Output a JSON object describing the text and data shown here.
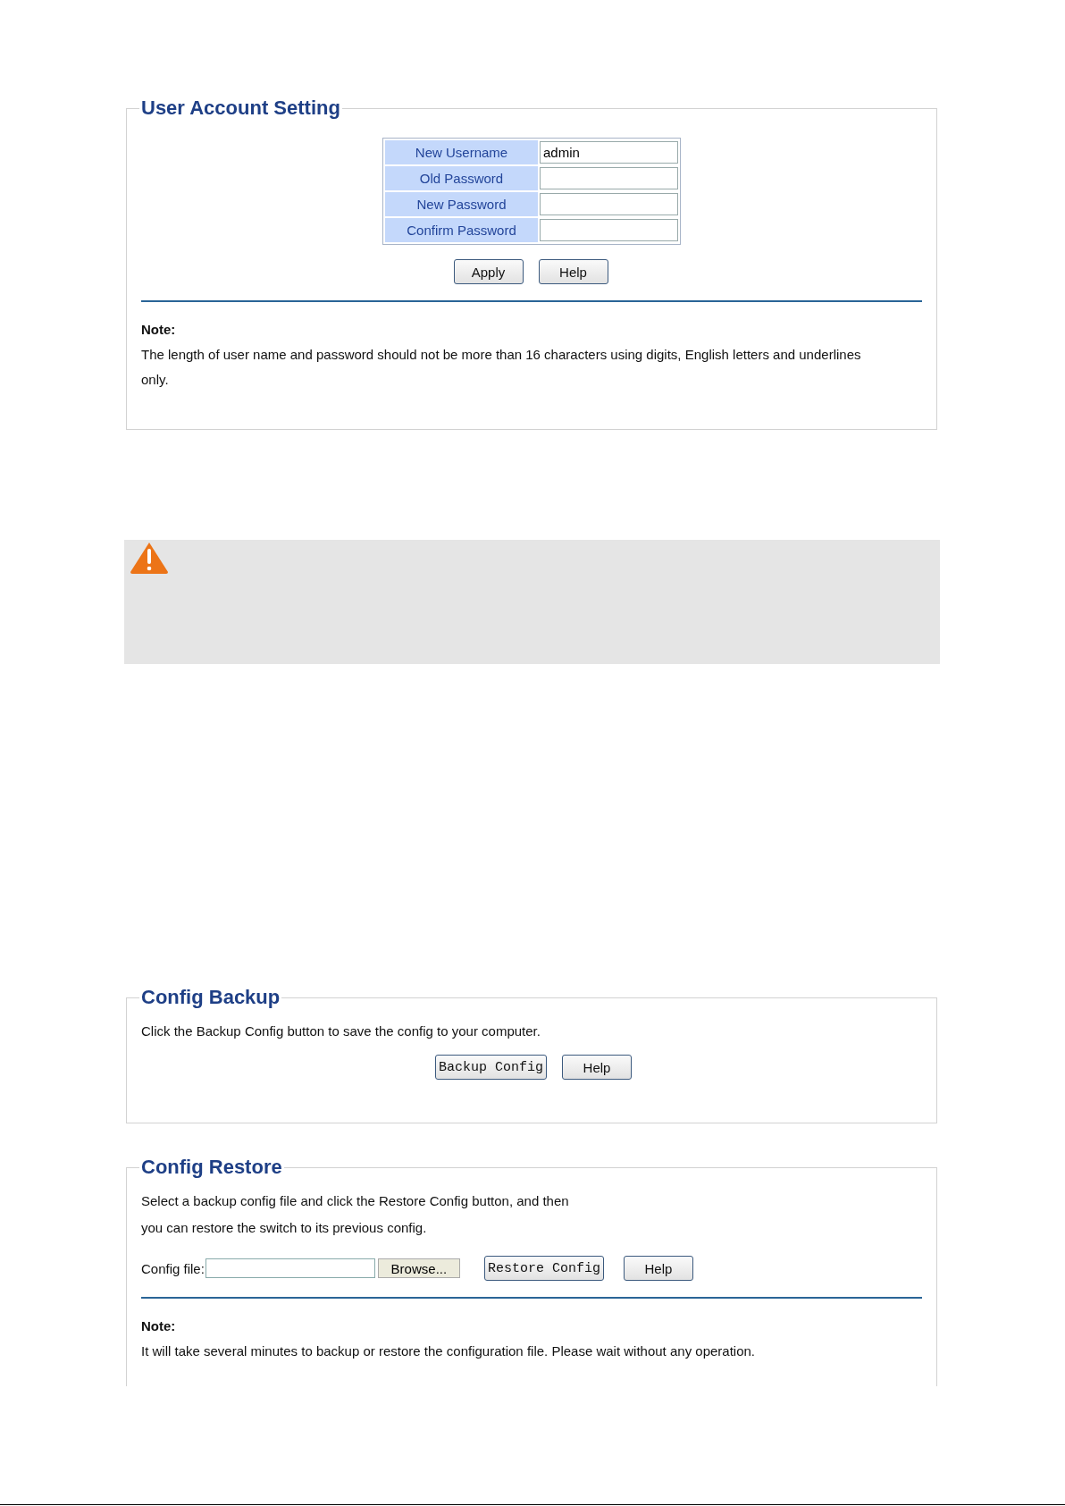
{
  "user_account": {
    "title": "User Account Setting",
    "fields": [
      {
        "label": "New Username",
        "value": "admin"
      },
      {
        "label": "Old Password"
      },
      {
        "label": "New Password"
      },
      {
        "label": "Confirm Password"
      }
    ],
    "buttons": [
      {
        "label": "Apply",
        "kind": "plain"
      },
      {
        "label": "Help",
        "kind": "plain"
      }
    ],
    "note_title": "Note:",
    "note": "The length of user name and password should not be more than 16 characters using digits, English letters and underlines only."
  },
  "warning": {
    "kind": "warning"
  },
  "config_backup": {
    "title": "Config Backup",
    "text": "Click the Backup Config button to save the config to your computer.",
    "buttons": [
      {
        "label": "Backup Config",
        "kind": "mono"
      },
      {
        "label": "Help",
        "kind": "plain"
      }
    ]
  },
  "config_restore": {
    "title": "Config Restore",
    "text_lines": [
      "Select a backup config file and click the Restore Config button, and then",
      "you can restore the switch to its previous config."
    ],
    "file_label": "Config file:",
    "browse": "Browse...",
    "buttons": [
      {
        "label": "Restore Config",
        "kind": "mono"
      },
      {
        "label": "Help",
        "kind": "plain"
      }
    ],
    "note_title": "Note:",
    "note": "It will take several minutes to backup or restore the configuration file. Please wait without any operation."
  }
}
